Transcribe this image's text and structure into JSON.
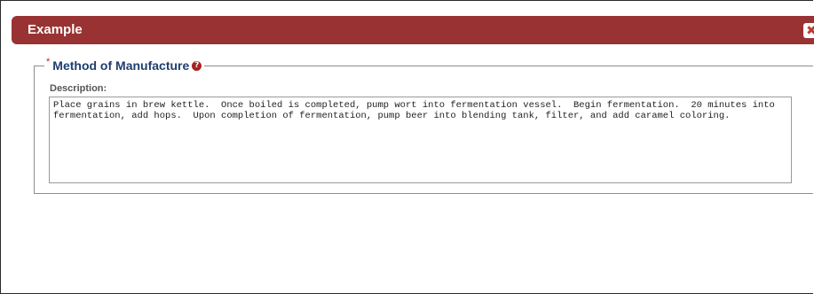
{
  "dialog": {
    "title": "Example",
    "close_icon": "close-icon"
  },
  "section": {
    "required_mark": "*",
    "legend": "Method of Manufacture",
    "help_icon": "question-icon",
    "help_glyph": "?"
  },
  "description": {
    "label": "Description:",
    "value": "Place grains in brew kettle.  Once boiled is completed, pump wort into fermentation vessel.  Begin fermentation.  20 minutes into fermentation, add hops.  Upon completion of fermentation, pump beer into blending tank, filter, and add caramel coloring."
  },
  "colors": {
    "titlebar": "#993333",
    "legend_text": "#1f3e6e",
    "required": "#cc2222"
  }
}
